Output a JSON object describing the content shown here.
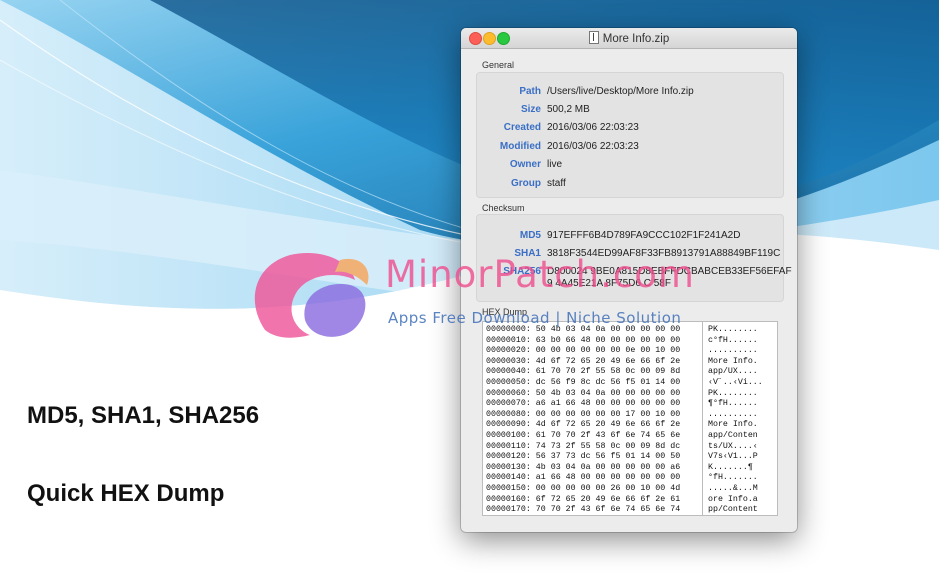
{
  "promo": {
    "line1": "MD5, SHA1, SHA256",
    "line2": "Quick HEX Dump"
  },
  "watermark": {
    "title": "MinorPatch.com",
    "subtitle": "Apps Free Download | Niche Solution"
  },
  "window": {
    "title": "More Info.zip",
    "general_label": "General",
    "checksum_label": "Checksum",
    "hex_label": "HEX Dump"
  },
  "general": [
    {
      "key": "Path",
      "value": "/Users/live/Desktop/More Info.zip"
    },
    {
      "key": "Size",
      "value": "500,2 MB"
    },
    {
      "key": "Created",
      "value": "2016/03/06 22:03:23"
    },
    {
      "key": "Modified",
      "value": "2016/03/06 22:03:23"
    },
    {
      "key": "Owner",
      "value": "live"
    },
    {
      "key": "Group",
      "value": "staff"
    }
  ],
  "checksum": [
    {
      "key": "MD5",
      "value": "917EFFF6B4D789FA9CCC102F1F241A2D"
    },
    {
      "key": "SHA1",
      "value": "3818F3544ED99AF8F33FB8913791A88849BF119C"
    },
    {
      "key": "SHA256",
      "value": "D800024 9BE0A815D8EBFFDCBABCEB33EF56EFAF"
    },
    {
      "key": "",
      "value": "9 4A45E21A 8F75D6 C 58F"
    }
  ],
  "hex": [
    {
      "line": "00000000: 50 4b 03 04 0a 00 00 00 00 00",
      "ascii": "PK........"
    },
    {
      "line": "00000010: 63 b0 66 48 00 00 00 00 00 00",
      "ascii": "c°fH......"
    },
    {
      "line": "00000020: 00 00 00 00 00 00 0e 00 10 00",
      "ascii": ".........."
    },
    {
      "line": "00000030: 4d 6f 72 65 20 49 6e 66 6f 2e",
      "ascii": "More Info."
    },
    {
      "line": "00000040: 61 70 70 2f 55 58 0c 00 09 8d",
      "ascii": "app/UX...."
    },
    {
      "line": "00000050: dc 56 f9 8c dc 56 f5 01 14 00",
      "ascii": "‹V˝..‹Vi..."
    },
    {
      "line": "00000060: 50 4b 03 04 0a 00 00 00 00 00",
      "ascii": "PK........"
    },
    {
      "line": "00000070: a6 a1 66 48 00 00 00 00 00 00",
      "ascii": "¶°fH......"
    },
    {
      "line": "00000080: 00 00 00 00 00 00 17 00 10 00",
      "ascii": ".........."
    },
    {
      "line": "00000090: 4d 6f 72 65 20 49 6e 66 6f 2e",
      "ascii": "More Info."
    },
    {
      "line": "00000100: 61 70 70 2f 43 6f 6e 74 65 6e",
      "ascii": "app/Conten"
    },
    {
      "line": "00000110: 74 73 2f 55 58 0c 00 09 8d dc",
      "ascii": "ts/UX....‹"
    },
    {
      "line": "00000120: 56 37 73 dc 56 f5 01 14 00 50",
      "ascii": "V7s‹V1...P"
    },
    {
      "line": "00000130: 4b 03 04 0a 00 00 00 00 00 a6",
      "ascii": "K.......¶"
    },
    {
      "line": "00000140: a1 66 48 00 00 00 00 00 00 00",
      "ascii": "°fH......."
    },
    {
      "line": "00000150: 00 00 00 00 00 26 00 10 00 4d",
      "ascii": ".....&...M"
    },
    {
      "line": "00000160: 6f 72 65 20 49 6e 66 6f 2e 61",
      "ascii": "ore Info.a"
    },
    {
      "line": "00000170: 70 70 2f 43 6f 6e 74 65 6e 74",
      "ascii": "pp/Content"
    }
  ],
  "colors": {
    "label_blue": "#3a6fc6",
    "watermark_pink": "#ef4e8e",
    "watermark_blue": "#3f6fb8",
    "close": "#fc5f57",
    "minimize": "#fdbc2e",
    "zoom": "#28c840"
  }
}
